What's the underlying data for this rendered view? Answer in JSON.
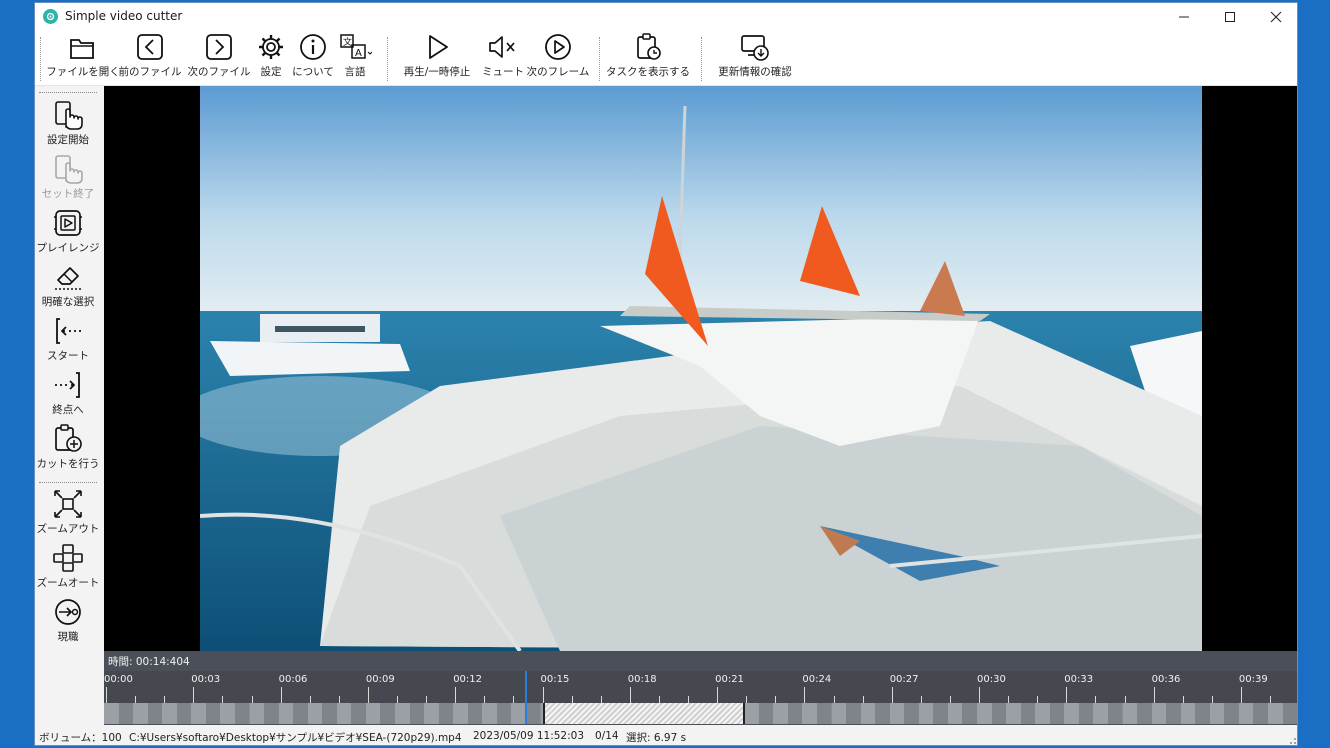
{
  "window": {
    "title": "Simple video cutter"
  },
  "toolbar": {
    "open_file": "ファイルを開く",
    "prev_file": "前のファイル",
    "next_file": "次のファイル",
    "settings": "設定",
    "about": "について",
    "language": "言語",
    "play_pause": "再生/一時停止",
    "mute": "ミュート",
    "next_frame": "次のフレーム",
    "show_tasks": "タスクを表示する",
    "check_updates": "更新情報の確認"
  },
  "sidebar": {
    "set_start": "設定開始",
    "set_end": "セット終了",
    "play_range": "プレイレンジ",
    "clear_selection": "明確な選択",
    "to_start": "スタート",
    "to_end": "終点へ",
    "do_cut": "カットを行う",
    "zoom_out": "ズームアウト",
    "zoom_auto": "ズームオート",
    "current": "現職"
  },
  "timeline": {
    "time_label": "時間: 00:14:404",
    "ticks": [
      "00:00",
      "00:03",
      "00:06",
      "00:09",
      "00:12",
      "00:15",
      "00:18",
      "00:21",
      "00:24",
      "00:27",
      "00:30",
      "00:33",
      "00:36",
      "00:39"
    ],
    "playhead_seconds": 14.404,
    "selection_start_seconds": 15.0,
    "selection_end_seconds": 21.97,
    "total_seconds": 41.0
  },
  "status": {
    "volume": "ボリューム：100",
    "path": "C:¥Users¥softaro¥Desktop¥サンプル¥ビデオ¥SEA-(720p29).mp4",
    "datetime": "2023/05/09 11:52:03",
    "position": "0/14",
    "selection": "選択: 6.97 s"
  },
  "colors": {
    "accent": "#2d7de0",
    "timeline_bg": "#4b5058",
    "app_icon": "#2fb3a8"
  }
}
